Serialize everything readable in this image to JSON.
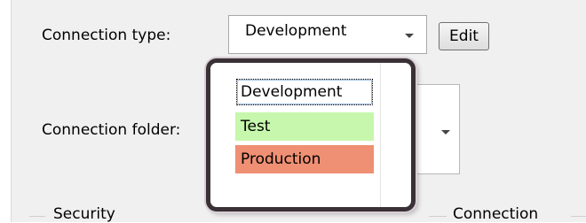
{
  "form": {
    "connection_type_label": "Connection type:",
    "connection_type_value": "Development",
    "edit_button_label": "Edit",
    "connection_folder_label": "Connection folder:"
  },
  "dropdown": {
    "options": [
      "Development",
      "Test",
      "Production"
    ],
    "selected": "Development",
    "option_colors": {
      "Development": "#ffffff",
      "Test": "#c7f7ac",
      "Production": "#ef8f73"
    }
  },
  "groups": {
    "security_label": "Security",
    "connection_label": "Connection"
  }
}
